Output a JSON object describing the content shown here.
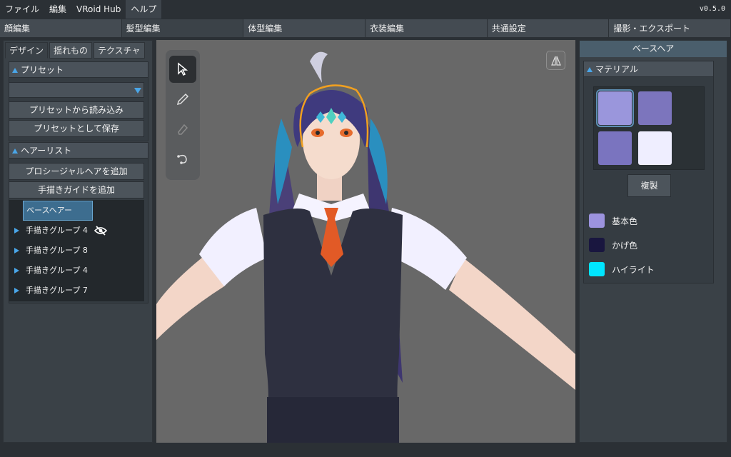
{
  "menu": {
    "items": [
      "ファイル",
      "編集",
      "VRoid Hub",
      "ヘルプ"
    ],
    "version": "v0.5.0"
  },
  "main_tabs": [
    "顔編集",
    "髪型編集",
    "体型編集",
    "衣装編集",
    "共通設定",
    "撮影・エクスポート"
  ],
  "left": {
    "sub_tabs": [
      "デザイン",
      "揺れもの",
      "テクスチャ"
    ],
    "preset": {
      "header": "プリセット",
      "dropdown_value": "",
      "load_button": "プリセットから読み込み",
      "save_button": "プリセットとして保存"
    },
    "hair_list": {
      "header": "ヘアーリスト",
      "add_procedural_button": "プロシージャルヘアを追加",
      "add_guide_button": "手描きガイドを追加",
      "base_item": "ベースヘアー",
      "groups": [
        "手描きグループ 4",
        "手描きグループ 8",
        "手描きグループ 4",
        "手描きグループ 7"
      ]
    }
  },
  "right": {
    "title": "ベースヘア",
    "material_header": "マテリアル",
    "duplicate_button": "複製",
    "swatches": [
      "#9a96dc",
      "#7c75bd",
      "#7a74bf",
      "#efeeff"
    ],
    "colors": [
      {
        "label": "基本色",
        "color": "#9c93de"
      },
      {
        "label": "かげ色",
        "color": "#19163f"
      },
      {
        "label": "ハイライト",
        "color": "#00e5ff"
      }
    ]
  }
}
